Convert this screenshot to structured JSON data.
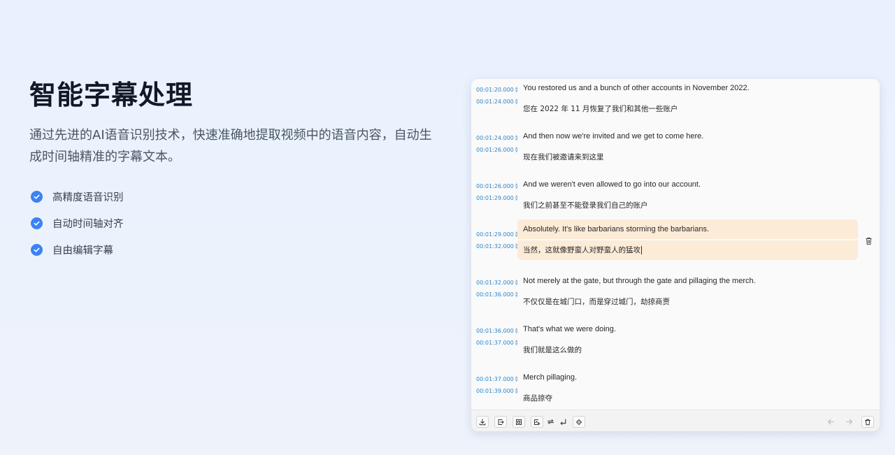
{
  "hero": {
    "title": "智能字幕处理",
    "description": "通过先进的AI语音识别技术，快速准确地提取视频中的语音内容，自动生成时间轴精准的字幕文本。",
    "features": [
      {
        "label": "高精度语音识别",
        "icon": "check-circle-icon"
      },
      {
        "label": "自动时间轴对齐",
        "icon": "check-circle-icon"
      },
      {
        "label": "自由编辑字幕",
        "icon": "check-circle-icon"
      }
    ]
  },
  "editor": {
    "accent_color": "#2a86c9",
    "highlight_color": "#fcebd6",
    "subtitles": [
      {
        "start": "00:01:20.000",
        "end": "00:01:24.000",
        "en": "You restored us and a bunch of other accounts in November 2022.",
        "zh": "您在 2022 年 11 月恢复了我们和其他一些账户",
        "active": false
      },
      {
        "start": "00:01:24.000",
        "end": "00:01:26.000",
        "en": "And then now we're invited and we get to come here.",
        "zh": "现在我们被邀请来到这里",
        "active": false
      },
      {
        "start": "00:01:26.000",
        "end": "00:01:29.000",
        "en": "And we weren't even allowed to go into our account.",
        "zh": "我们之前甚至不能登录我们自己的账户",
        "active": false
      },
      {
        "start": "00:01:29.000",
        "end": "00:01:32.000",
        "en": "Absolutely. It's like barbarians storming the barbarians.",
        "zh": "当然，这就像野蛮人对野蛮人的猛攻",
        "active": true
      },
      {
        "start": "00:01:32.000",
        "end": "00:01:36.000",
        "en": "Not merely at the gate, but through the gate and pillaging the merch.",
        "zh": "不仅仅是在城门口，而是穿过城门，劫掠商贾",
        "active": false
      },
      {
        "start": "00:01:36.000",
        "end": "00:01:37.000",
        "en": "That's what we were doing.",
        "zh": "我们就是这么做的",
        "active": false
      },
      {
        "start": "00:01:37.000",
        "end": "00:01:39.000",
        "en": "Merch pillaging.",
        "zh": "商品掠夺",
        "active": false
      }
    ],
    "toolbar": {
      "left": [
        "download-icon",
        "import-icon",
        "frame-icon",
        "export-image-icon",
        "swap-icon",
        "line-break-icon",
        "locate-icon"
      ],
      "right": [
        "arrow-left-icon",
        "arrow-right-icon",
        "trash-icon"
      ]
    }
  }
}
